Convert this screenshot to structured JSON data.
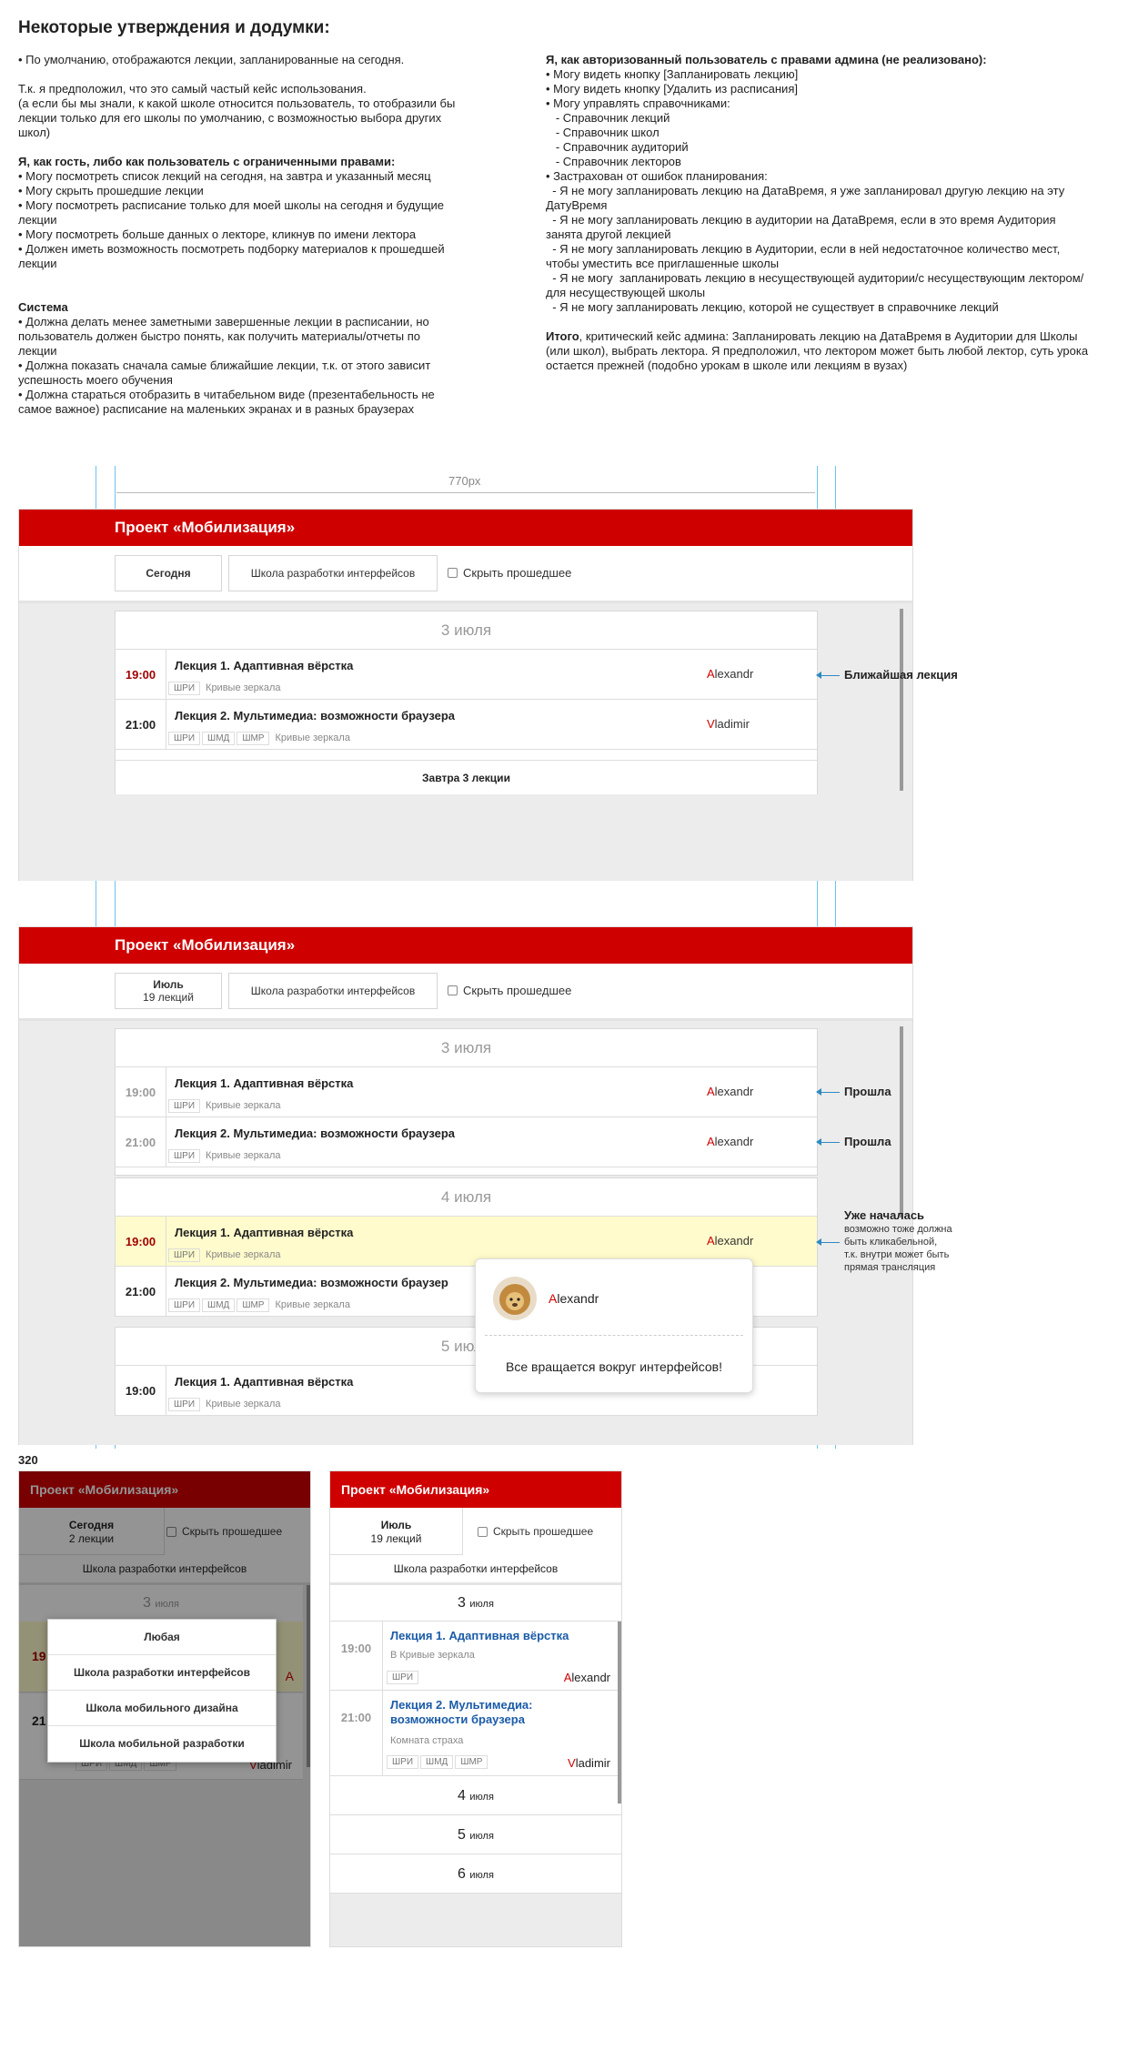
{
  "notes": {
    "title": "Некоторые утверждения и додумки:",
    "left": [
      {
        "lines": [
          "• По умолчанию, отображаются лекции, запланированные на сегодня."
        ]
      },
      {
        "lines": [
          "Т.к. я предположил, что это самый частый кейс использования.",
          "(а если бы мы знали, к какой школе относится пользователь, то отобразили бы",
          "лекции только для его школы по умолчанию, с возможностью выбора других",
          "школ)"
        ]
      },
      {
        "heading": "Я, как гость, либо как пользователь с ограниченными правами:",
        "lines": [
          "• Могу посмотреть список лекций на сегодня, на завтра и указанный месяц",
          "• Могу скрыть прошедшие лекции",
          "• Могу посмотреть расписание только для моей школы на сегодня и будущие",
          "лекции",
          "• Могу посмотреть больше данных о лекторе, кликнув по имени лектора",
          "• Должен иметь возможность посмотреть подборку материалов к прошедшей",
          "лекции"
        ]
      },
      {
        "heading": "Система",
        "lines": [
          "• Должна делать менее заметными завершенные лекции в расписании, но",
          "пользователь должен быстро понять, как получить материалы/отчеты по",
          "лекции",
          "•  Должна показать сначала самые ближайшие лекции, т.к. от этого зависит",
          "успешность моего обучения",
          "• Должна стараться отобразить в читабельном виде (презентабельность не",
          "самое важное) расписание на маленьких экранах и в разных браузерах"
        ]
      }
    ],
    "right": [
      {
        "heading": "Я, как авторизованный пользователь с правами админа (не реализовано):",
        "lines": [
          "• Могу видеть кнопку [Запланировать лекцию]",
          "• Могу видеть кнопку [Удалить из расписания]",
          "• Могу управлять справочниками:",
          "   - Справочник лекций",
          "   - Справочник школ",
          "   - Справочник аудиторий",
          "   - Справочник лекторов",
          "• Застрахован от ошибок планирования:",
          "  - Я не могу запланировать лекцию на ДатаВремя, я уже запланировал другую лекцию на эту",
          "ДатуВремя",
          "  - Я не могу запланировать лекцию в аудитории на ДатаВремя, если в это время Аудитория",
          "занята другой лекцией",
          "  - Я не могу запланировать лекцию в Аудитории, если в ней недостаточное количество мест,",
          "чтобы уместить все приглашенные школы",
          "  - Я не могу  запланировать лекцию в несуществующей аудитории/с несуществующим лектором/",
          "для несуществующей школы",
          "  - Я не могу запланировать лекцию, которой не существует в справочнике лекций"
        ]
      },
      {
        "heading_inline": "Итого",
        "lines": [
          ", критический кейс админа: Запланировать лекцию на ДатаВремя в Аудитории для Школы",
          "(или школ), выбрать лектора. Я предположил, что лектором может быть любой лектор, суть урока",
          "остается прежней (подобно урокам в школе или лекциям в вузах)"
        ]
      }
    ]
  },
  "dim_label": "770px",
  "mobile_label": "320",
  "app": {
    "title": "Проект «Мобилизация»",
    "today": "Сегодня",
    "school": "Школа разработки интерфейсов",
    "hide_past": "Скрыть прошедшее",
    "month": "Июль",
    "month_count": "19 лекций",
    "tomorrow": "Завтра 3 лекции"
  },
  "tags": {
    "shri": "ШРИ",
    "shmd": "ШМД",
    "shmr": "ШМР"
  },
  "place": "Кривые зеркала",
  "place_mobile": "В Кривые зеркала",
  "place_room": "Комната страха",
  "days": {
    "d3": "3 июля",
    "d4": "4 июля",
    "d5": "5 июля",
    "d3n": "3",
    "d4n": "4",
    "d5n": "5",
    "d6n": "6",
    "month_word": "июля"
  },
  "lectures": {
    "l1": "Лекция 1. Адаптивная вёрстка",
    "l2": "Лекция 2. Мультимедиа: возможности браузера",
    "l2a": "Лекция 2. Мультимедиа:",
    "l2b": "возможности браузера",
    "l2cut": "Лекция 2. Мультимедиа: возможности браузер"
  },
  "times": {
    "t19": "19:00",
    "t21": "21:00"
  },
  "lecturers": {
    "a_first": "A",
    "a_rest": "lexandr",
    "v_first": "V",
    "v_rest": "ladimir"
  },
  "annotations": {
    "nearest": "Ближайшая лекция",
    "past": "Прошла",
    "started": "Уже началась",
    "started_sub": [
      "возможно тоже должна",
      "быть кликабельной,",
      "т.к. внутри может быть",
      "прямая трансляция"
    ]
  },
  "popup": {
    "name": "Alexandr",
    "text": "Все вращается вокруг интерфейсов!"
  },
  "mobile1": {
    "today": "Сегодня",
    "count": "2 лекции",
    "menu": [
      "Любая",
      "Школа разработки интерфейсов",
      "Школа мобильного дизайна",
      "Школа мобильной разработки"
    ],
    "peek_time": "19",
    "peek_time2": "21",
    "peek_author": "A"
  },
  "colors": {
    "brand": "#cf0000",
    "active_row": "#fffbcc",
    "link": "#1a5ba8",
    "guide": "#6fc2ef"
  }
}
